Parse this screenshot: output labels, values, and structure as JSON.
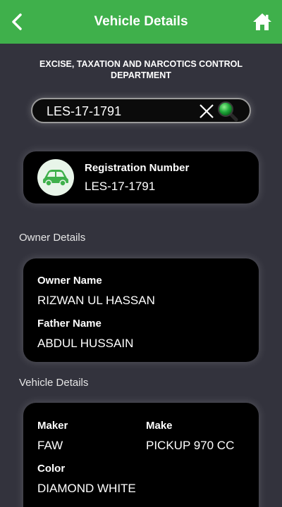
{
  "header": {
    "title": "Vehicle Details",
    "back_icon": "chevron-left-icon",
    "home_icon": "home-icon",
    "bar_color": "#3fb04b"
  },
  "department": "EXCISE, TAXATION AND NARCOTICS CONTROL DEPARTMENT",
  "search": {
    "value": "LES-17-1791",
    "clear_icon": "close-icon",
    "search_icon": "search-icon"
  },
  "registration": {
    "icon": "car-icon",
    "label": "Registration Number",
    "value": "LES-17-1791"
  },
  "owner_section": {
    "title": "Owner Details",
    "owner_name_label": "Owner Name",
    "owner_name_value": "RIZWAN UL HASSAN",
    "father_name_label": "Father Name",
    "father_name_value": "ABDUL HUSSAIN"
  },
  "vehicle_section": {
    "title": "Vehicle Details",
    "maker_label": "Maker",
    "maker_value": "FAW",
    "make_label": "Make",
    "make_value": "PICKUP 970 CC",
    "color_label": "Color",
    "color_value": "DIAMOND WHITE"
  }
}
